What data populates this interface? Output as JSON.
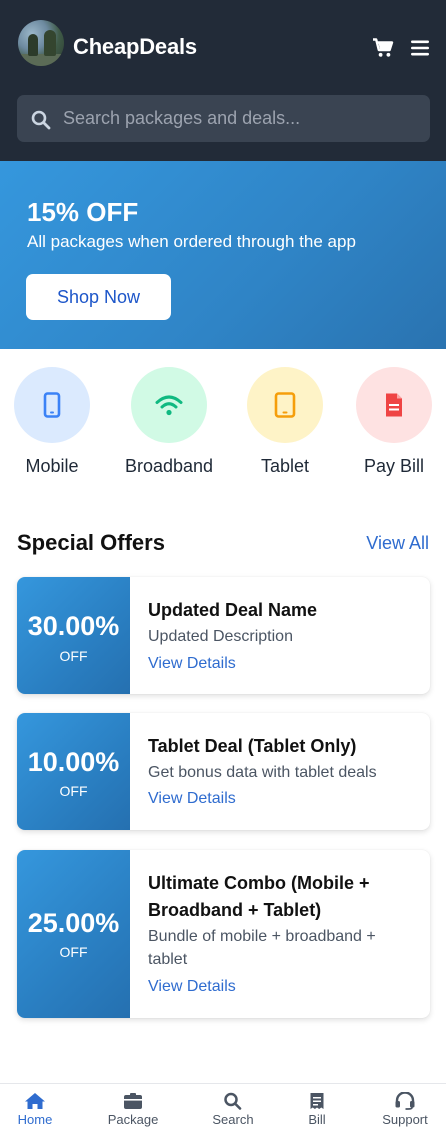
{
  "header": {
    "brand": "CheapDeals",
    "search_placeholder": "Search packages and deals..."
  },
  "banner": {
    "title": "15% OFF",
    "subtitle": "All packages when ordered through the app",
    "button": "Shop Now"
  },
  "categories": [
    {
      "label": "Mobile",
      "icon": "mobile-icon",
      "bg": "#dbeafe",
      "color": "#3b82f6"
    },
    {
      "label": "Broadband",
      "icon": "wifi-icon",
      "bg": "#d1fae5",
      "color": "#10b981"
    },
    {
      "label": "Tablet",
      "icon": "tablet-icon",
      "bg": "#fef3c7",
      "color": "#f59e0b"
    },
    {
      "label": "Pay Bill",
      "icon": "bill-icon",
      "bg": "#fee2e2",
      "color": "#ef4444"
    }
  ],
  "special_offers": {
    "title": "Special Offers",
    "view_all": "View All",
    "offers": [
      {
        "discount": "30.00%",
        "off": "OFF",
        "title": "Updated Deal Name",
        "description": "Updated Description",
        "link": "View Details"
      },
      {
        "discount": "10.00%",
        "off": "OFF",
        "title": "Tablet Deal (Tablet Only)",
        "description": "Get bonus data with tablet deals",
        "link": "View Details"
      },
      {
        "discount": "25.00%",
        "off": "OFF",
        "title": "Ultimate Combo (Mobile + Broadband + Tablet)",
        "description": "Bundle of mobile + broadband + tablet",
        "link": "View Details"
      }
    ]
  },
  "bottom_nav": [
    {
      "label": "Home",
      "icon": "home-icon",
      "active": true
    },
    {
      "label": "Package",
      "icon": "package-icon",
      "active": false
    },
    {
      "label": "Search",
      "icon": "search-icon",
      "active": false
    },
    {
      "label": "Bill",
      "icon": "bill-icon",
      "active": false
    },
    {
      "label": "Support",
      "icon": "headset-icon",
      "active": false
    }
  ],
  "colors": {
    "header_bg": "#222b38",
    "accent": "#2f6ccf",
    "banner_gradient": "#3597dd"
  }
}
